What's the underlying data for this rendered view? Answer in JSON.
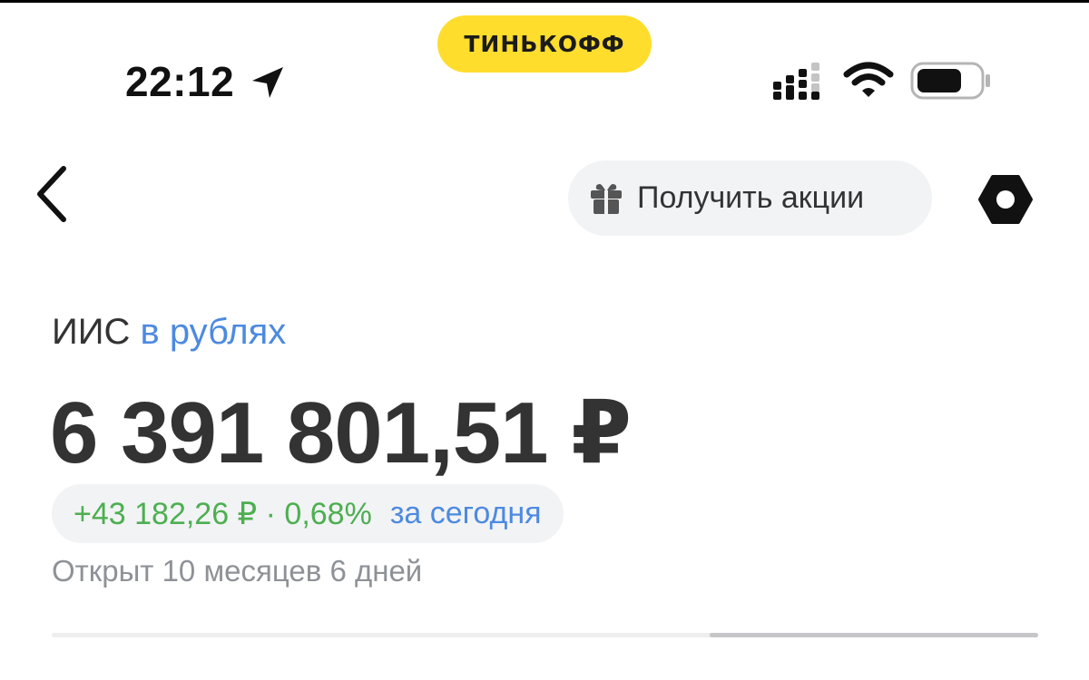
{
  "status_bar": {
    "time": "22:12",
    "location_icon": "location-arrow-icon",
    "signal_icon": "cellular-signal-icon",
    "wifi_icon": "wifi-icon",
    "battery_icon": "battery-icon"
  },
  "brand": {
    "name": "ТИНЬКОФФ",
    "color": "#ffdd2d"
  },
  "nav": {
    "back_icon": "chevron-left-icon",
    "promo_label": "Получить акции",
    "promo_icon": "gift-icon",
    "settings_icon": "settings-hexagon-icon"
  },
  "account": {
    "type": "ИИС",
    "currency_link": "в рублях",
    "balance": "6 391 801,51 ₽",
    "change": "+43 182,26 ₽ · 0,68%",
    "change_period": "за сегодня",
    "opened": "Открыт 10 месяцев 6 дней"
  },
  "colors": {
    "positive": "#4caf50",
    "link": "#4d8ae0",
    "secondary_text": "#8e9297",
    "pill_background": "#f2f3f5"
  },
  "scroll": {
    "thumb_fraction": 0.33
  }
}
